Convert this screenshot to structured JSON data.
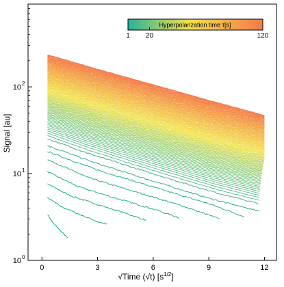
{
  "chart_data": {
    "type": "line",
    "xlabel": "√Time (√t) [s",
    "xlabel_sup": "1/2",
    "xlabel_end": "]",
    "ylabel": "Signal [au]",
    "x_scale": "linear",
    "y_scale": "log",
    "xlim": [
      -0.75,
      12.65
    ],
    "ylim": [
      1,
      900
    ],
    "x_ticks": [
      0,
      3,
      6,
      9,
      12
    ],
    "x_tick_labels": [
      "0",
      "3",
      "6",
      "9",
      "12"
    ],
    "y_ticks": [
      1,
      10,
      100
    ],
    "y_tick_labels": [
      "10",
      "10",
      "10"
    ],
    "y_tick_exponents": [
      "0",
      "1",
      "2"
    ],
    "grid": false,
    "colorbar": {
      "label": "Hyperpolarization time τ[s]",
      "ticks": [
        1,
        20,
        120
      ],
      "tick_labels": [
        "1",
        "20",
        "120"
      ],
      "range": [
        1,
        120
      ],
      "colors": [
        "#26b29a",
        "#f2e24a",
        "#f47a4a"
      ]
    },
    "series_rule": {
      "tau_min": 1,
      "tau_max": 120,
      "tau_step": 1,
      "x_start": 0.3,
      "x_end": 12.0,
      "note": "one decay curve per hyperpolarization time, colored by colorbar"
    },
    "series": [
      {
        "tau": 1,
        "x": [
          0.3,
          0.6,
          0.9,
          1.2,
          1.4
        ],
        "y": [
          3.4,
          2.7,
          2.3,
          2.0,
          1.8
        ]
      },
      {
        "tau": 2,
        "x": [
          0.3,
          1.0,
          2.0,
          3.0,
          3.5
        ],
        "y": [
          5.3,
          4.2,
          3.4,
          2.8,
          2.6
        ]
      },
      {
        "tau": 3,
        "x": [
          0.3,
          1.5,
          3.0,
          4.5,
          5.6
        ],
        "y": [
          7.6,
          5.6,
          4.4,
          3.5,
          2.9
        ]
      },
      {
        "tau": 4,
        "x": [
          0.3,
          2.0,
          4.0,
          6.0,
          7.4
        ],
        "y": [
          10.5,
          7.0,
          5.2,
          3.9,
          3.1
        ]
      },
      {
        "tau": 6,
        "x": [
          0.3,
          2.5,
          5.0,
          7.5,
          9.6
        ],
        "y": [
          14.5,
          9.0,
          6.2,
          4.3,
          3.0
        ]
      },
      {
        "tau": 8,
        "x": [
          0.3,
          3.0,
          6.0,
          9.0,
          10.9
        ],
        "y": [
          18.0,
          11.0,
          7.0,
          4.5,
          3.2
        ]
      },
      {
        "tau": 10,
        "x": [
          0.3,
          3.0,
          6.0,
          9.0,
          11.7
        ],
        "y": [
          21.0,
          13.0,
          8.2,
          5.2,
          3.7
        ]
      },
      {
        "tau": 120,
        "x": [
          0.3,
          3.0,
          6.0,
          9.0,
          12.0
        ],
        "y": [
          235,
          160,
          106,
          70,
          47
        ]
      }
    ]
  }
}
